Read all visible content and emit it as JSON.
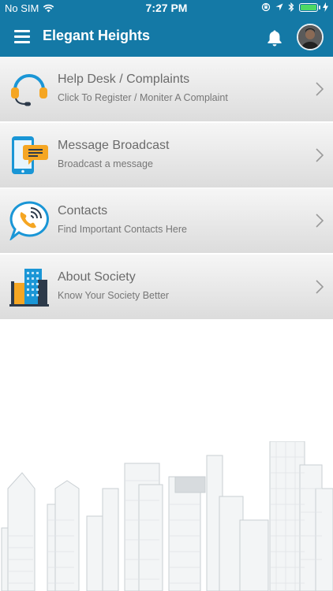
{
  "status_bar": {
    "carrier": "No SIM",
    "time": "7:27 PM"
  },
  "app_bar": {
    "title": "Elegant Heights",
    "menu_icon": "hamburger-icon",
    "notification_icon": "bell-icon"
  },
  "menu": {
    "items": [
      {
        "label": "Help Desk / Complaints",
        "subtitle": "Click To Register / Moniter A Complaint",
        "icon": "headset-icon"
      },
      {
        "label": "Message Broadcast",
        "subtitle": "Broadcast a message",
        "icon": "phone-message-icon"
      },
      {
        "label": "Contacts",
        "subtitle": "Find Important Contacts Here",
        "icon": "phone-call-icon"
      },
      {
        "label": "About Society",
        "subtitle": "Know Your Society Better",
        "icon": "buildings-icon"
      }
    ]
  },
  "colors": {
    "app_bar": "#1479a6",
    "battery": "#4cd964",
    "menu_text": "#6b6b6b"
  }
}
